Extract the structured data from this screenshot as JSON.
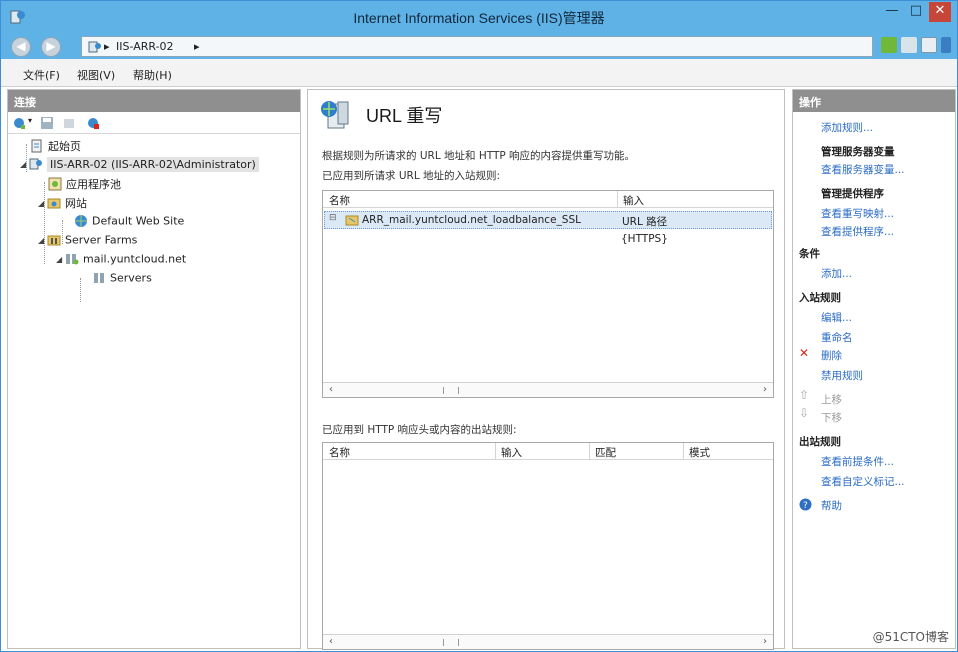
{
  "window": {
    "title": "Internet Information Services (IIS)管理器",
    "controls": {
      "minimize": "—",
      "maximize": "□",
      "close": "✕"
    }
  },
  "address": {
    "breadcrumbs": [
      "IIS-ARR-02"
    ],
    "separator": "▸"
  },
  "menu": {
    "items": [
      "文件(F)",
      "视图(V)",
      "帮助(H)"
    ]
  },
  "connections": {
    "header": "连接",
    "tree": [
      {
        "label": "起始页",
        "level": 0,
        "icon": "start-page-icon"
      },
      {
        "label": "IIS-ARR-02 (IIS-ARR-02\\Administrator)",
        "level": 0,
        "icon": "server-icon",
        "expanded": true,
        "selected": true
      },
      {
        "label": "应用程序池",
        "level": 1,
        "icon": "app-pool-icon"
      },
      {
        "label": "网站",
        "level": 1,
        "icon": "sites-folder-icon",
        "expanded": true
      },
      {
        "label": "Default Web Site",
        "level": 2,
        "icon": "globe-icon"
      },
      {
        "label": "Server Farms",
        "level": 1,
        "icon": "server-farms-icon",
        "expanded": true
      },
      {
        "label": "mail.yuntcloud.net",
        "level": 2,
        "icon": "farm-icon",
        "expanded": true
      },
      {
        "label": "Servers",
        "level": 3,
        "icon": "servers-icon"
      }
    ]
  },
  "feature": {
    "title": "URL 重写",
    "description": "根据规则为所请求的 URL 地址和 HTTP 响应的内容提供重写功能。",
    "inbound_caption": "已应用到所请求 URL 地址的入站规则:",
    "inbound_columns": [
      "名称",
      "输入"
    ],
    "inbound_rows": [
      {
        "name": "ARR_mail.yuntcloud.net_loadbalance_SSL",
        "input": "URL 路径",
        "extra": "{HTTPS}"
      }
    ],
    "outbound_caption": "已应用到 HTTP 响应头或内容的出站规则:",
    "outbound_columns": [
      "名称",
      "输入",
      "匹配",
      "模式"
    ]
  },
  "actions": {
    "header": "操作",
    "add_rule": "添加规则...",
    "server_vars_group": "管理服务器变量",
    "view_server_vars": "查看服务器变量...",
    "providers_group": "管理提供程序",
    "view_rewrite_maps": "查看重写映射...",
    "view_providers": "查看提供程序...",
    "conditions_group": "条件",
    "add_condition": "添加...",
    "inbound_group": "入站规则",
    "edit": "编辑...",
    "rename": "重命名",
    "delete": "删除",
    "disable_rule": "禁用规则",
    "move_up": "上移",
    "move_down": "下移",
    "outbound_group": "出站规则",
    "view_preconditions": "查看前提条件...",
    "view_custom_tags": "查看自定义标记...",
    "help": "帮助"
  },
  "watermark": "@51CTO博客",
  "colors": {
    "titlebar": "#5fb2e6",
    "panel_header": "#8f8f8f",
    "link": "#2b6cc4",
    "selection": "#dbe9f7",
    "delete_red": "#d9261c"
  }
}
